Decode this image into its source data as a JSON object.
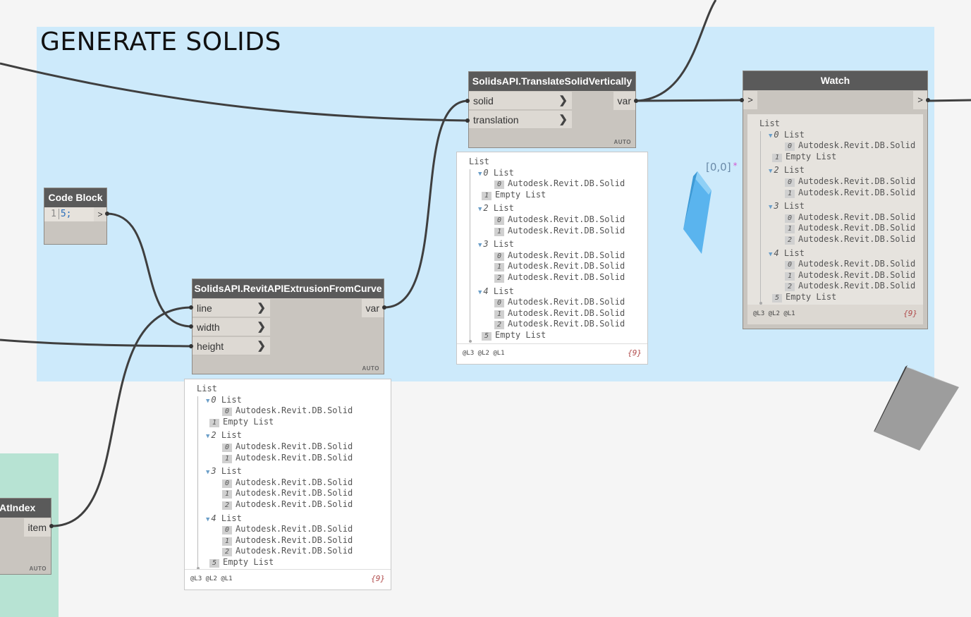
{
  "group": {
    "title": "GENERATE SOLIDS"
  },
  "code_block": {
    "title": "Code Block",
    "line_number": "1",
    "code": "5;",
    "output": ">"
  },
  "extrusion_node": {
    "title": "SolidsAPI.RevitAPIExtrusionFromCurve",
    "inputs": [
      "line",
      "width",
      "height"
    ],
    "output": "var",
    "lacing": "AUTO"
  },
  "translate_node": {
    "title": "SolidsAPI.TranslateSolidVertically",
    "inputs": [
      "solid",
      "translation"
    ],
    "output": "var",
    "lacing": "AUTO"
  },
  "watch_node": {
    "title": "Watch",
    "input": ">",
    "output": ">"
  },
  "getitem_node": {
    "title": "AtIndex",
    "output": "item",
    "lacing": "AUTO"
  },
  "preview_tree": {
    "root": "List",
    "rows": [
      {
        "kind": "list",
        "idx": "0",
        "label": "List"
      },
      {
        "kind": "item",
        "idx": "0",
        "label": "Autodesk.Revit.DB.Solid"
      },
      {
        "kind": "empty",
        "idx": "1",
        "label": "Empty List"
      },
      {
        "kind": "list",
        "idx": "2",
        "label": "List"
      },
      {
        "kind": "item",
        "idx": "0",
        "label": "Autodesk.Revit.DB.Solid"
      },
      {
        "kind": "item",
        "idx": "1",
        "label": "Autodesk.Revit.DB.Solid"
      },
      {
        "kind": "list",
        "idx": "3",
        "label": "List"
      },
      {
        "kind": "item",
        "idx": "0",
        "label": "Autodesk.Revit.DB.Solid"
      },
      {
        "kind": "item",
        "idx": "1",
        "label": "Autodesk.Revit.DB.Solid"
      },
      {
        "kind": "item",
        "idx": "2",
        "label": "Autodesk.Revit.DB.Solid"
      },
      {
        "kind": "list",
        "idx": "4",
        "label": "List"
      },
      {
        "kind": "item",
        "idx": "0",
        "label": "Autodesk.Revit.DB.Solid"
      },
      {
        "kind": "item",
        "idx": "1",
        "label": "Autodesk.Revit.DB.Solid"
      },
      {
        "kind": "item",
        "idx": "2",
        "label": "Autodesk.Revit.DB.Solid"
      },
      {
        "kind": "empty",
        "idx": "5",
        "label": "Empty List"
      }
    ],
    "levels": "@L3 @L2 @L1",
    "count": "{9}"
  },
  "viewport": {
    "label": "[0,0]",
    "star": "*"
  },
  "colors": {
    "group_blue": "#cdeafb",
    "group_green": "#b7e3d3",
    "node_header": "#5a5a5a",
    "solid_blue": "#5ab4ee",
    "solid_gray": "#999999"
  }
}
